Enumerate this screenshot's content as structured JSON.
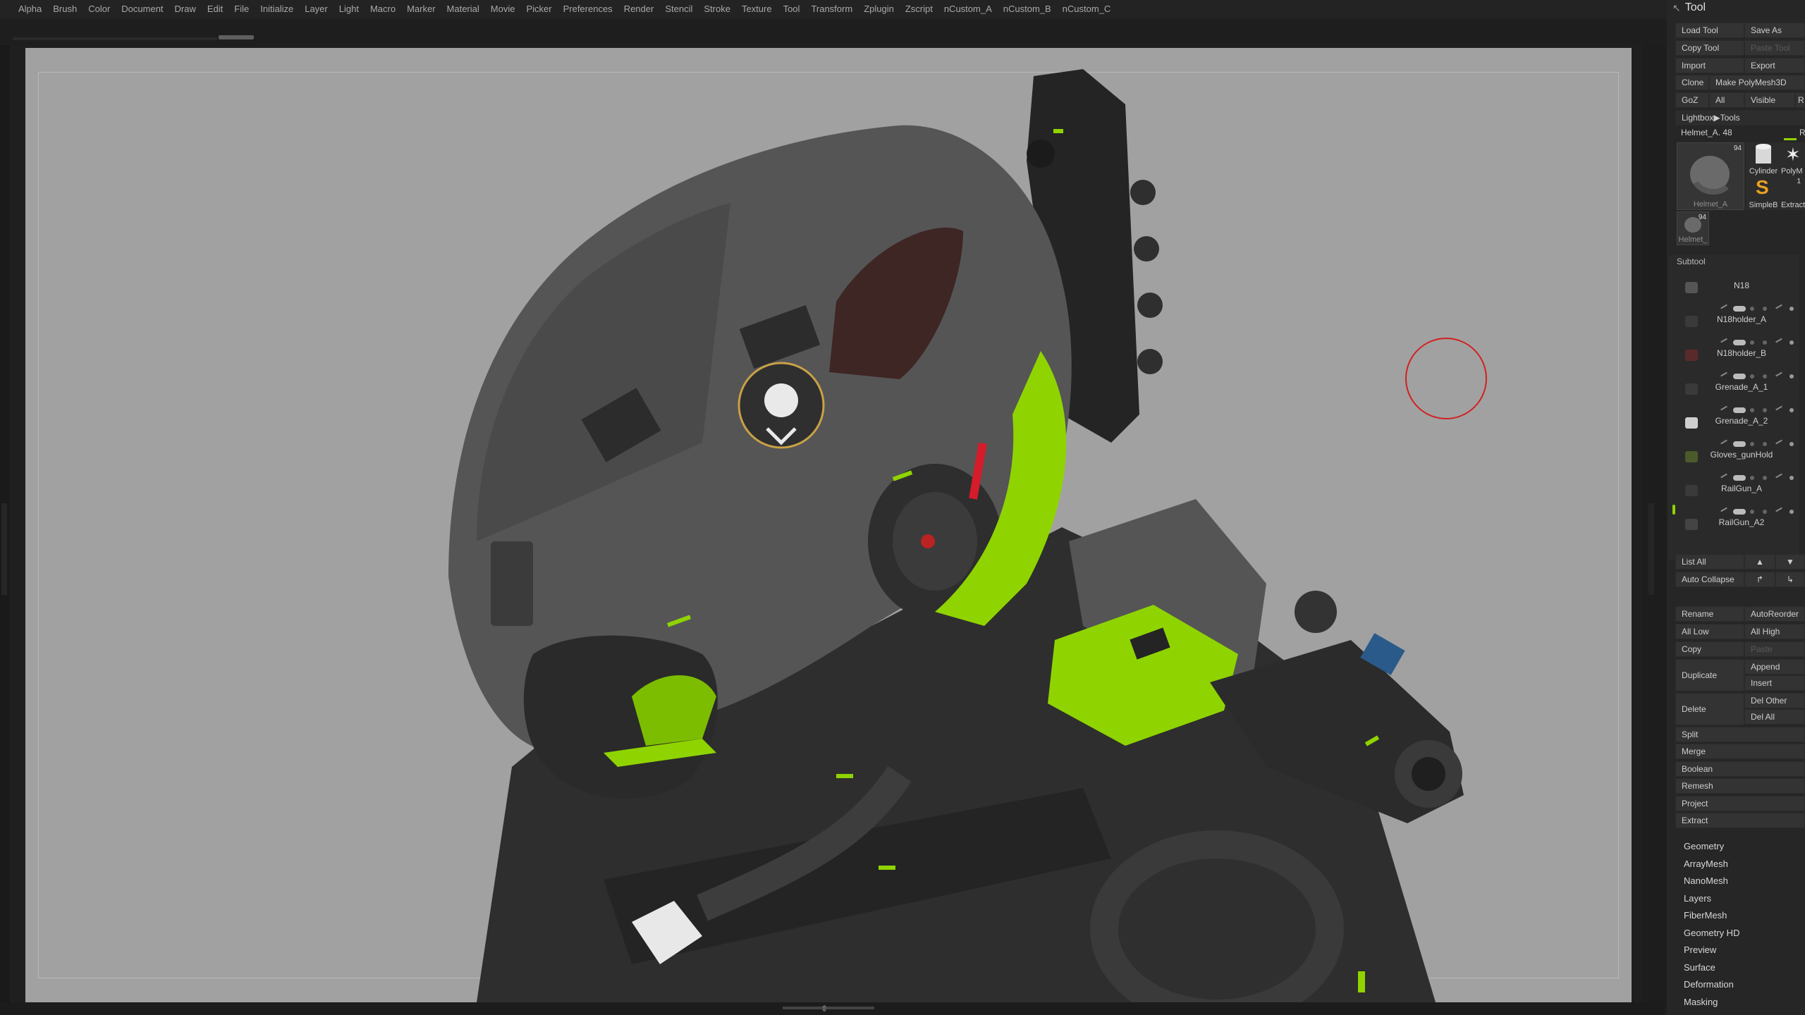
{
  "menu": [
    "Alpha",
    "Brush",
    "Color",
    "Document",
    "Draw",
    "Edit",
    "File",
    "Initialize",
    "Layer",
    "Light",
    "Macro",
    "Marker",
    "Material",
    "Movie",
    "Picker",
    "Preferences",
    "Render",
    "Stencil",
    "Stroke",
    "Texture",
    "Tool",
    "Transform",
    "Zplugin",
    "Zscript",
    "nCustom_A",
    "nCustom_B",
    "nCustom_C"
  ],
  "tool_panel": {
    "title": "Tool",
    "load_tool": "Load Tool",
    "save_as": "Save As",
    "copy_tool": "Copy Tool",
    "paste_tool": "Paste Tool",
    "import": "Import",
    "export": "Export",
    "clone": "Clone",
    "make_polymesh": "Make PolyMesh3D",
    "goz": "GoZ",
    "all": "All",
    "visible": "Visible",
    "r": "R",
    "lightbox": "Lightbox▶Tools",
    "current_tool": "Helmet_A. 48",
    "r2": "R",
    "thumbs": {
      "main_caption": "Helmet_A",
      "main_num": "94",
      "cylinder": "Cylinder",
      "polymesh": "PolyM",
      "simplebrush": "SimpleB",
      "extract": "Extract",
      "small_caption": "Helmet_",
      "small_num": "94",
      "small_num2": "1"
    }
  },
  "subtool": {
    "title": "Subtool",
    "items": [
      "N18",
      "N18holder_A",
      "N18holder_B",
      "Grenade_A_1",
      "Grenade_A_2",
      "Gloves_gunHold",
      "RailGun_A",
      "RailGun_A2"
    ]
  },
  "subtool_actions": {
    "list_all": "List All",
    "auto_collapse": "Auto Collapse",
    "rename": "Rename",
    "auto_reorder": "AutoReorder",
    "all_low": "All Low",
    "all_high": "All High",
    "copy": "Copy",
    "paste": "Paste",
    "duplicate": "Duplicate",
    "append": "Append",
    "insert": "Insert",
    "delete": "Delete",
    "del_other": "Del Other",
    "del_all": "Del All",
    "split": "Split",
    "merge": "Merge",
    "boolean": "Boolean",
    "remesh": "Remesh",
    "project": "Project",
    "extract": "Extract"
  },
  "sub_menus": [
    "Geometry",
    "ArrayMesh",
    "NanoMesh",
    "Layers",
    "FiberMesh",
    "Geometry HD",
    "Preview",
    "Surface",
    "Deformation",
    "Masking"
  ],
  "colors": {
    "accent_green": "#8fd400",
    "canvas_bg": "#a1a1a1",
    "cursor_red": "#d42020"
  },
  "icons": {
    "pin": "pin-icon",
    "subtool_up": "arrow-up-icon",
    "subtool_down": "arrow-down-icon"
  }
}
